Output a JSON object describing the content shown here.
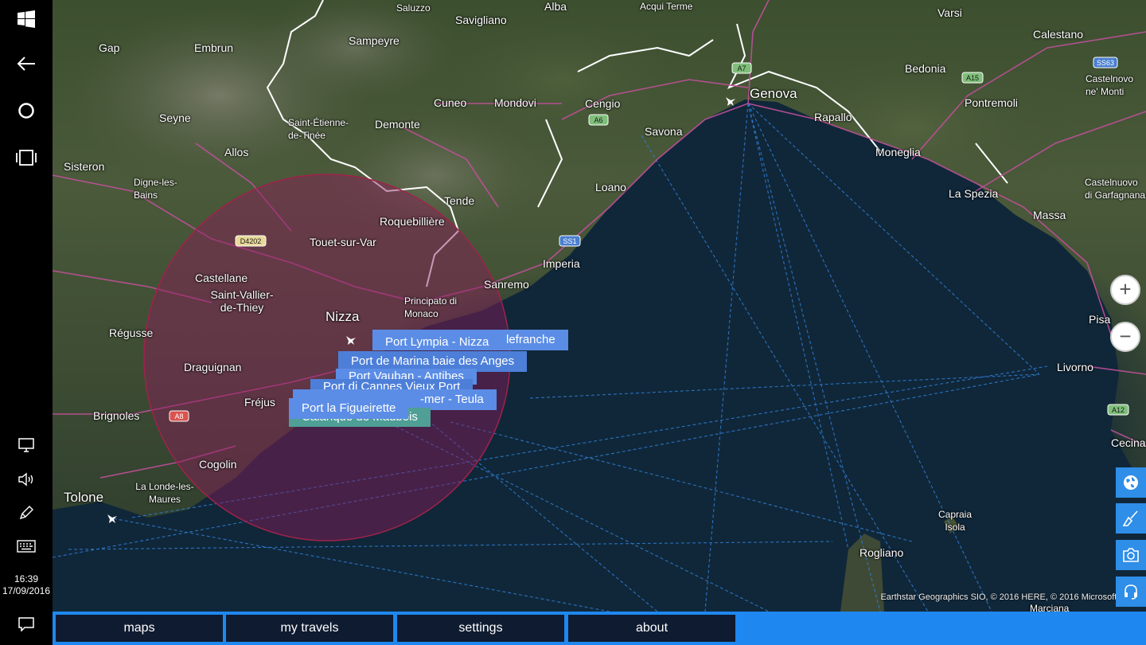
{
  "system": {
    "time": "16:39",
    "date": "17/09/2016"
  },
  "map": {
    "attribution": "Earthstar Geographics  SIO, © 2016 HERE, © 2016 Microsoft Corpor",
    "places": [
      {
        "name": "Gap"
      },
      {
        "name": "Embrun"
      },
      {
        "name": "Sampeyre"
      },
      {
        "name": "Saluzzo"
      },
      {
        "name": "Savigliano"
      },
      {
        "name": "Alba"
      },
      {
        "name": "Acqui Terme"
      },
      {
        "name": "Varsi"
      },
      {
        "name": "Calestano"
      },
      {
        "name": "Bedonia"
      },
      {
        "name": "Castelnovo ne' Monti"
      },
      {
        "name": "Seyne"
      },
      {
        "name": "Cuneo"
      },
      {
        "name": "Mondovi"
      },
      {
        "name": "Cengio"
      },
      {
        "name": "Genova"
      },
      {
        "name": "Rapallo"
      },
      {
        "name": "Pontremoli"
      },
      {
        "name": "Saint-Étienne-de-Tinée"
      },
      {
        "name": "Demonte"
      },
      {
        "name": "Savona"
      },
      {
        "name": "Allos"
      },
      {
        "name": "Sisteron"
      },
      {
        "name": "Moneglia"
      },
      {
        "name": "Digne-les-Bains"
      },
      {
        "name": "Tende"
      },
      {
        "name": "Loano"
      },
      {
        "name": "La Spezia"
      },
      {
        "name": "Massa"
      },
      {
        "name": "Castelnuovo di Garfagnana"
      },
      {
        "name": "Roquebillière"
      },
      {
        "name": "Touet-sur-Var"
      },
      {
        "name": "Imperia"
      },
      {
        "name": "Castellane"
      },
      {
        "name": "Sanremo"
      },
      {
        "name": "Principato di Monaco"
      },
      {
        "name": "Saint-Vallier-de-Thiey"
      },
      {
        "name": "Nizza"
      },
      {
        "name": "Pisa"
      },
      {
        "name": "Régusse"
      },
      {
        "name": "Draguignan"
      },
      {
        "name": "Livorno"
      },
      {
        "name": "Fréjus"
      },
      {
        "name": "Brignoles"
      },
      {
        "name": "Cecina"
      },
      {
        "name": "Cogolin"
      },
      {
        "name": "La Londe-les-Maures"
      },
      {
        "name": "Tolone"
      },
      {
        "name": "Capraia Isola"
      },
      {
        "name": "Rogliano"
      },
      {
        "name": "Marciana"
      }
    ],
    "road_shields": [
      "A7",
      "A6",
      "A15",
      "SS63",
      "D4202",
      "SS1",
      "A8",
      "A12"
    ],
    "marinas": [
      {
        "label": "lefranche"
      },
      {
        "label": "Port Lympia - Nizza"
      },
      {
        "label": "Port de Marina baie des Anges"
      },
      {
        "label": "Port Vauban - Antibes"
      },
      {
        "label": "Port di Cannes Vieux Port"
      },
      {
        "label": "-mer - Teula"
      },
      {
        "label": "Calanque de Maubois"
      },
      {
        "label": "Port la Figueirette"
      }
    ],
    "zoom_in": "+",
    "zoom_out": "−"
  },
  "tools": [
    {
      "icon": "globe-icon"
    },
    {
      "icon": "brush-icon"
    },
    {
      "icon": "camera-icon"
    },
    {
      "icon": "headset-icon"
    }
  ],
  "nav": {
    "maps": "maps",
    "my_travels": "my travels",
    "settings": "settings",
    "about": "about"
  },
  "colors": {
    "accent": "#1e88f0",
    "nav_button": "#0f1b30",
    "marina_label": "#5b8de6",
    "radius_circle": "#8b1a5a"
  }
}
